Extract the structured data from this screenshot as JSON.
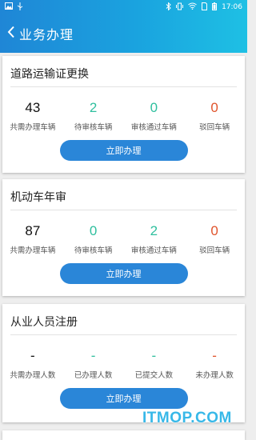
{
  "status_bar": {
    "time": "17:06",
    "left_icons": [
      "image-icon",
      "usb-icon"
    ],
    "right_icons": [
      "bluetooth-icon",
      "vibrate-icon",
      "wifi-icon",
      "sim-icon",
      "battery-icon"
    ]
  },
  "header": {
    "title": "业务办理",
    "back_icon": "chevron-left-icon"
  },
  "cards": [
    {
      "title": "道路运输证更换",
      "stats": [
        {
          "value": "43",
          "label": "共需办理车辆",
          "color": "#111111"
        },
        {
          "value": "2",
          "label": "待审核车辆",
          "color": "#2fbf9e"
        },
        {
          "value": "0",
          "label": "审核通过车辆",
          "color": "#2fbf9e"
        },
        {
          "value": "0",
          "label": "驳回车辆",
          "color": "#e0542c"
        }
      ],
      "button_label": "立即办理"
    },
    {
      "title": "机动车年审",
      "stats": [
        {
          "value": "87",
          "label": "共需办理车辆",
          "color": "#111111"
        },
        {
          "value": "0",
          "label": "待审核车辆",
          "color": "#2fbf9e"
        },
        {
          "value": "2",
          "label": "审核通过车辆",
          "color": "#2fbf9e"
        },
        {
          "value": "0",
          "label": "驳回车辆",
          "color": "#e0542c"
        }
      ],
      "button_label": "立即办理"
    },
    {
      "title": "从业人员注册",
      "stats": [
        {
          "value": "-",
          "label": "共需办理人数",
          "color": "#111111"
        },
        {
          "value": "-",
          "label": "已办理人数",
          "color": "#2fbf9e"
        },
        {
          "value": "-",
          "label": "已提交人数",
          "color": "#2fbf9e"
        },
        {
          "value": "-",
          "label": "未办理人数",
          "color": "#e0542c"
        }
      ],
      "button_label": "立即办理"
    }
  ],
  "watermark": "ITMOP.COM",
  "colors": {
    "header_gradient_start": "#1f86d6",
    "header_gradient_end": "#1ec0e4",
    "button": "#2a86d8",
    "green": "#2fbf9e",
    "red": "#e0542c"
  }
}
